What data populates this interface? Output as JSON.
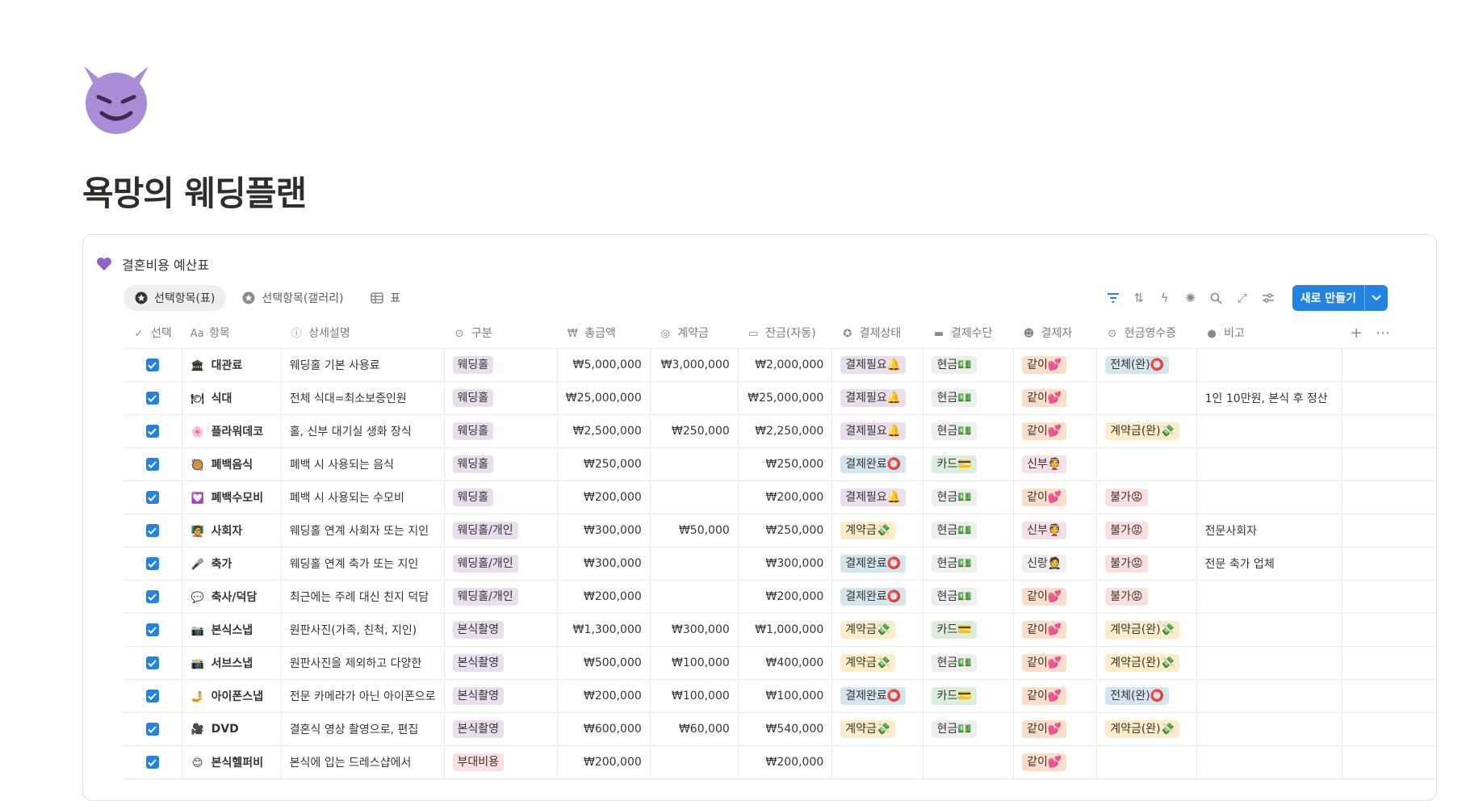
{
  "page": {
    "title": "욕망의 웨딩플랜",
    "icon": "smiling-devil-icon"
  },
  "database": {
    "title": "결혼비용 예산표",
    "icon": "purple-heart-icon",
    "views": [
      {
        "label": "선택항목(표)",
        "icon": "star-circle-icon",
        "active": true
      },
      {
        "label": "선택항목(갤러리)",
        "icon": "star-circle-icon",
        "active": false
      },
      {
        "label": "표",
        "icon": "table-icon",
        "active": false
      }
    ],
    "toolbar": {
      "icons": [
        "filter-icon",
        "sort-icon",
        "automation-icon",
        "loading-icon",
        "search-icon",
        "expand-icon",
        "settings-icon"
      ],
      "new_button_label": "새로 만들기"
    },
    "columns": [
      {
        "label": "선택",
        "icon": "checkmark-icon"
      },
      {
        "label": "항목",
        "icon": "text-icon"
      },
      {
        "label": "상세설명",
        "icon": "info-icon"
      },
      {
        "label": "구분",
        "icon": "select-icon"
      },
      {
        "label": "총금액",
        "icon": "money-icon"
      },
      {
        "label": "계약금",
        "icon": "coins-icon"
      },
      {
        "label": "잔금(자동)",
        "icon": "formula-icon"
      },
      {
        "label": "결제상태",
        "icon": "star-circle-icon"
      },
      {
        "label": "결제수단",
        "icon": "card-icon"
      },
      {
        "label": "결제자",
        "icon": "person-icon"
      },
      {
        "label": "현금영수증",
        "icon": "select-icon"
      },
      {
        "label": "비고",
        "icon": "comment-icon"
      }
    ],
    "colors": {
      "웨딩홀": "#e8deee",
      "웨딩홀/개인": "#e8deee",
      "본식촬영": "#e8deee",
      "부대비용": "#fadfde",
      "결제필요": "#e8deee",
      "결제완료": "#d3e5ef",
      "계약금": "#fdecc8",
      "현금": "#efeeec",
      "카드": "#dbeddb",
      "같이": "#fadec9",
      "신부": "#f5e0e9",
      "신랑": "#efeeec",
      "전체(완)": "#d3e5ef",
      "계약금(완)": "#fdecc8",
      "불가": "#fadfde"
    },
    "rows": [
      {
        "checked": true,
        "emoji": "🏛",
        "name": "대관료",
        "detail": "웨딩홀 기본 사용료",
        "category": "웨딩홀",
        "total": "₩5,000,000",
        "deposit": "₩3,000,000",
        "balance": "₩2,000,000",
        "status": "결제필요🔔",
        "status_key": "결제필요",
        "method": "현금💵",
        "method_key": "현금",
        "payer": "같이💕",
        "payer_key": "같이",
        "receipt": "전체(완)⭕",
        "receipt_key": "전체(완)",
        "note": ""
      },
      {
        "checked": true,
        "emoji": "🍽",
        "name": "식대",
        "detail": "전체 식대=최소보증인원",
        "category": "웨딩홀",
        "total": "₩25,000,000",
        "deposit": "",
        "balance": "₩25,000,000",
        "status": "결제필요🔔",
        "status_key": "결제필요",
        "method": "현금💵",
        "method_key": "현금",
        "payer": "같이💕",
        "payer_key": "같이",
        "receipt": "",
        "receipt_key": "",
        "note": "1인 10만원, 본식 후 정산"
      },
      {
        "checked": true,
        "emoji": "🌸",
        "name": "플라워데코",
        "detail": "홀, 신부 대기실 생화 장식",
        "category": "웨딩홀",
        "total": "₩2,500,000",
        "deposit": "₩250,000",
        "balance": "₩2,250,000",
        "status": "결제필요🔔",
        "status_key": "결제필요",
        "method": "현금💵",
        "method_key": "현금",
        "payer": "같이💕",
        "payer_key": "같이",
        "receipt": "계약금(완)💸",
        "receipt_key": "계약금(완)",
        "note": ""
      },
      {
        "checked": true,
        "emoji": "🥘",
        "name": "폐백음식",
        "detail": "폐백 시 사용되는 음식",
        "category": "웨딩홀",
        "total": "₩250,000",
        "deposit": "",
        "balance": "₩250,000",
        "status": "결제완료⭕",
        "status_key": "결제완료",
        "method": "카드💳",
        "method_key": "카드",
        "payer": "신부👰",
        "payer_key": "신부",
        "receipt": "",
        "receipt_key": "",
        "note": ""
      },
      {
        "checked": true,
        "emoji": "💟",
        "name": "폐백수모비",
        "detail": "폐백 시 사용되는 수모비",
        "category": "웨딩홀",
        "total": "₩200,000",
        "deposit": "",
        "balance": "₩200,000",
        "status": "결제필요🔔",
        "status_key": "결제필요",
        "method": "현금💵",
        "method_key": "현금",
        "payer": "같이💕",
        "payer_key": "같이",
        "receipt": "불가😡",
        "receipt_key": "불가",
        "note": ""
      },
      {
        "checked": true,
        "emoji": "🧑‍🏫",
        "name": "사회자",
        "detail": "웨딩홀 연계 사회자 또는 지인",
        "category": "웨딩홀/개인",
        "total": "₩300,000",
        "deposit": "₩50,000",
        "balance": "₩250,000",
        "status": "계약금💸",
        "status_key": "계약금",
        "method": "현금💵",
        "method_key": "현금",
        "payer": "신부👰",
        "payer_key": "신부",
        "receipt": "불가😡",
        "receipt_key": "불가",
        "note": "전문사회자"
      },
      {
        "checked": true,
        "emoji": "🎤",
        "name": "축가",
        "detail": "웨딩홀 연계 축가 또는 지인",
        "category": "웨딩홀/개인",
        "total": "₩300,000",
        "deposit": "",
        "balance": "₩300,000",
        "status": "결제완료⭕",
        "status_key": "결제완료",
        "method": "현금💵",
        "method_key": "현금",
        "payer": "신랑🤵",
        "payer_key": "신랑",
        "receipt": "불가😡",
        "receipt_key": "불가",
        "note": "전문 축가 업체"
      },
      {
        "checked": true,
        "emoji": "💬",
        "name": "축사/덕담",
        "detail": "최근에는 주례 대신 친지 덕담",
        "category": "웨딩홀/개인",
        "total": "₩200,000",
        "deposit": "",
        "balance": "₩200,000",
        "status": "결제완료⭕",
        "status_key": "결제완료",
        "method": "현금💵",
        "method_key": "현금",
        "payer": "같이💕",
        "payer_key": "같이",
        "receipt": "불가😡",
        "receipt_key": "불가",
        "note": ""
      },
      {
        "checked": true,
        "emoji": "📷",
        "name": "본식스냅",
        "detail": "원판사진(가족, 친척, 지인)",
        "category": "본식촬영",
        "total": "₩1,300,000",
        "deposit": "₩300,000",
        "balance": "₩1,000,000",
        "status": "계약금💸",
        "status_key": "계약금",
        "method": "카드💳",
        "method_key": "카드",
        "payer": "같이💕",
        "payer_key": "같이",
        "receipt": "계약금(완)💸",
        "receipt_key": "계약금(완)",
        "note": ""
      },
      {
        "checked": true,
        "emoji": "📸",
        "name": "서브스냅",
        "detail": "원판사진을 제외하고 다양한",
        "category": "본식촬영",
        "total": "₩500,000",
        "deposit": "₩100,000",
        "balance": "₩400,000",
        "status": "계약금💸",
        "status_key": "계약금",
        "method": "현금💵",
        "method_key": "현금",
        "payer": "같이💕",
        "payer_key": "같이",
        "receipt": "계약금(완)💸",
        "receipt_key": "계약금(완)",
        "note": ""
      },
      {
        "checked": true,
        "emoji": "🤳",
        "name": "아이폰스냅",
        "detail": "전문 카메라가 아닌 아이폰으로",
        "category": "본식촬영",
        "total": "₩200,000",
        "deposit": "₩100,000",
        "balance": "₩100,000",
        "status": "결제완료⭕",
        "status_key": "결제완료",
        "method": "카드💳",
        "method_key": "카드",
        "payer": "같이💕",
        "payer_key": "같이",
        "receipt": "전체(완)⭕",
        "receipt_key": "전체(완)",
        "note": ""
      },
      {
        "checked": true,
        "emoji": "🎥",
        "name": "DVD",
        "detail": "결혼식 영상 촬영으로, 편집",
        "category": "본식촬영",
        "total": "₩600,000",
        "deposit": "₩60,000",
        "balance": "₩540,000",
        "status": "계약금💸",
        "status_key": "계약금",
        "method": "현금💵",
        "method_key": "현금",
        "payer": "같이💕",
        "payer_key": "같이",
        "receipt": "계약금(완)💸",
        "receipt_key": "계약금(완)",
        "note": ""
      },
      {
        "checked": true,
        "emoji": "😊",
        "name": "본식헬퍼비",
        "detail": "본식에 입는 드레스샵에서",
        "category": "부대비용",
        "total": "₩200,000",
        "deposit": "",
        "balance": "₩200,000",
        "status": "",
        "status_key": "",
        "method": "",
        "method_key": "",
        "payer": "같이💕",
        "payer_key": "같이",
        "receipt": "",
        "receipt_key": "",
        "note": ""
      }
    ]
  }
}
